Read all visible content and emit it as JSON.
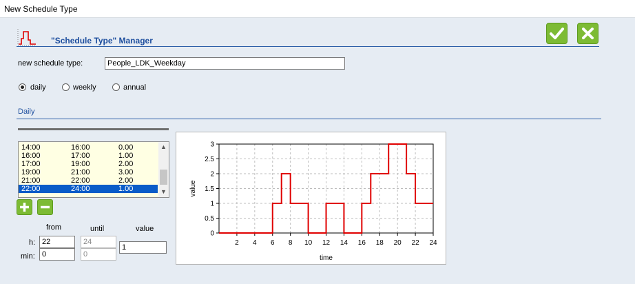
{
  "window": {
    "title": "New Schedule Type"
  },
  "header": {
    "title": "\"Schedule Type\" Manager",
    "ok_icon": "checkmark-icon",
    "cancel_icon": "x-icon"
  },
  "form": {
    "name_label": "new schedule type:",
    "name_value": "People_LDK_Weekday",
    "radios": [
      {
        "label": "daily",
        "checked": true
      },
      {
        "label": "weekly",
        "checked": false
      },
      {
        "label": "annual",
        "checked": false
      }
    ]
  },
  "daily": {
    "section_title": "Daily",
    "rows": [
      {
        "from": "14:00",
        "until": "16:00",
        "value": "0.00"
      },
      {
        "from": "16:00",
        "until": "17:00",
        "value": "1.00"
      },
      {
        "from": "17:00",
        "until": "19:00",
        "value": "2.00"
      },
      {
        "from": "19:00",
        "until": "21:00",
        "value": "3.00"
      },
      {
        "from": "21:00",
        "until": "22:00",
        "value": "2.00"
      },
      {
        "from": "22:00",
        "until": "24:00",
        "value": "1.00",
        "selected": true
      }
    ],
    "editor": {
      "from_label": "from",
      "until_label": "until",
      "value_label": "value",
      "h_label": "h:",
      "min_label": "min:",
      "from_h": "22",
      "from_min": "0",
      "until_h": "24",
      "until_min": "0",
      "value": "1"
    }
  },
  "chart_data": {
    "type": "line",
    "step": true,
    "xlabel": "time",
    "ylabel": "value",
    "xlim": [
      0,
      24
    ],
    "ylim": [
      0,
      3
    ],
    "xticks": [
      2,
      4,
      6,
      8,
      10,
      12,
      14,
      16,
      18,
      20,
      22,
      24
    ],
    "yticks": [
      0,
      0.5,
      1,
      1.5,
      2,
      2.5,
      3
    ],
    "grid": true,
    "line_color": "#e00000",
    "x": [
      0,
      6,
      6,
      7,
      7,
      8,
      8,
      10,
      10,
      12,
      12,
      14,
      14,
      16,
      16,
      17,
      17,
      19,
      19,
      21,
      21,
      22,
      22,
      24
    ],
    "y": [
      0,
      0,
      1,
      1,
      2,
      2,
      1,
      1,
      0,
      0,
      1,
      1,
      0,
      0,
      1,
      1,
      2,
      2,
      3,
      3,
      2,
      2,
      1,
      1
    ]
  }
}
